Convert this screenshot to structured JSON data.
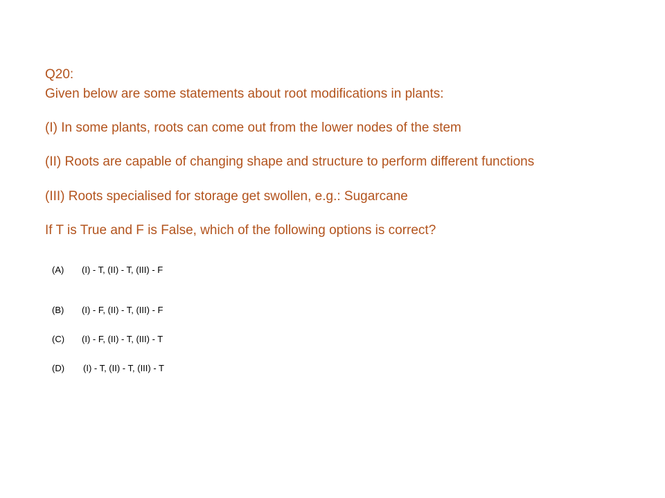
{
  "question": {
    "number": "Q20:",
    "intro": "Given below are some statements about root modifications in plants:",
    "statements": [
      "(I) In some plants, roots can come out from the lower nodes of the stem",
      "(II) Roots are capable of changing shape and structure to perform different functions",
      "(III) Roots specialised for storage get swollen, e.g.: Sugarcane"
    ],
    "prompt": "If T is True and F is False, which of the following options is correct?"
  },
  "options": [
    {
      "letter": "(A)",
      "text": "(I) - T, (II) - T, (III) - F"
    },
    {
      "letter": "(B)",
      "text": "(I) - F, (II) - T, (III) - F"
    },
    {
      "letter": "(C)",
      "text": "(I) - F, (II) - T, (III) - T"
    },
    {
      "letter": "(D)",
      "text": "(I) - T, (II) - T, (III) - T"
    }
  ]
}
